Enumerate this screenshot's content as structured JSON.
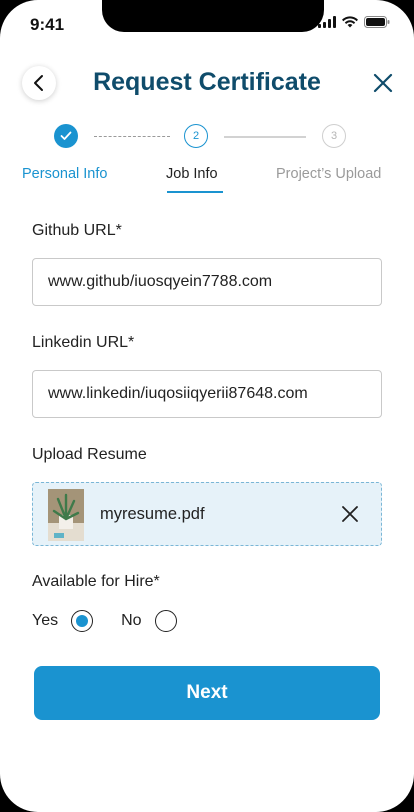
{
  "status_bar": {
    "time": "9:41"
  },
  "header": {
    "title": "Request Certificate"
  },
  "stepper": {
    "step2": "2",
    "step3": "3"
  },
  "tabs": [
    {
      "label": "Personal Info",
      "state": "completed"
    },
    {
      "label": "Job Info",
      "state": "active"
    },
    {
      "label": "Project’s Upload",
      "state": "pending"
    }
  ],
  "form": {
    "github": {
      "label": "Github URL*",
      "value": "www.github/iuosqyein7788.com"
    },
    "linkedin": {
      "label": "Linkedin URL*",
      "value": "www.linkedin/iuqosiiqyerii87648.com"
    },
    "resume": {
      "label": "Upload Resume",
      "file_name": "myresume.pdf"
    },
    "hire": {
      "label": "Available for Hire*",
      "yes": "Yes",
      "no": "No",
      "selected": "Yes"
    }
  },
  "next_button": "Next",
  "colors": {
    "primary": "#1a93d0",
    "title": "#0f4c6b",
    "upload_bg": "#e6f2f9"
  }
}
